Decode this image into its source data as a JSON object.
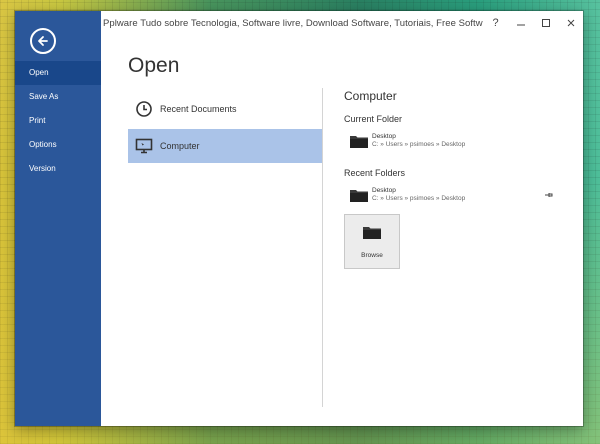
{
  "window": {
    "title": "Pplware   Tudo sobre Tecnologia, Software livre, Download Software, Tutoriais, Free Software...",
    "controls": {
      "help": "?",
      "minimize": "–",
      "restore": "▫",
      "close": "✕"
    }
  },
  "nav": {
    "items": [
      {
        "label": "Open",
        "active": true
      },
      {
        "label": "Save As"
      },
      {
        "label": "Print"
      },
      {
        "label": "Options"
      },
      {
        "label": "Version"
      }
    ]
  },
  "main": {
    "title": "Open",
    "places": [
      {
        "label": "Recent Documents",
        "icon": "clock-icon"
      },
      {
        "label": "Computer",
        "icon": "computer-icon",
        "selected": true
      }
    ]
  },
  "computer_pane": {
    "title": "Computer",
    "current_folder": {
      "heading": "Current Folder",
      "name": "Desktop",
      "path": "C: » Users » psimoes » Desktop"
    },
    "recent_folders": {
      "heading": "Recent Folders",
      "items": [
        {
          "name": "Desktop",
          "path": "C: » Users » psimoes » Desktop"
        }
      ]
    },
    "browse_label": "Browse"
  },
  "colors": {
    "nav_bg": "#2b579a",
    "nav_active": "#19478a",
    "selected_place": "#aac3e8"
  }
}
